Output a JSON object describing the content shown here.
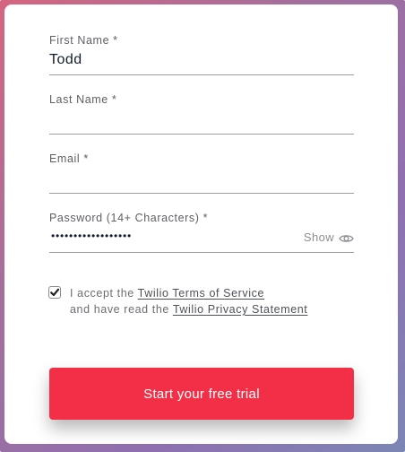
{
  "form": {
    "first_name": {
      "label": "First Name *",
      "value": "Todd"
    },
    "last_name": {
      "label": "Last Name *",
      "value": ""
    },
    "email": {
      "label": "Email *",
      "value": ""
    },
    "password": {
      "label": "Password (14+ Characters) *",
      "masked_value": "••••••••••••••••••",
      "show_label": "Show",
      "show_icon": "eye-icon"
    },
    "terms": {
      "checked": true,
      "check_icon": "checkmark-icon",
      "line1_prefix": "I accept the ",
      "terms_link": "Twilio Terms of Service",
      "line2_prefix": "and have read the ",
      "privacy_link": "Twilio Privacy Statement"
    },
    "submit_label": "Start your free trial"
  },
  "colors": {
    "accent": "#f22f46",
    "text": "#121c2d",
    "label": "#5c5f63",
    "border_gradient_start": "#d5657f",
    "border_gradient_end": "#7c86b5"
  }
}
